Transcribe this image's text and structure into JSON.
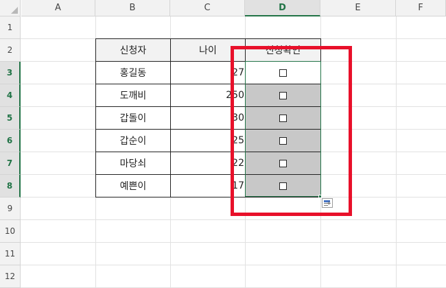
{
  "columns": [
    "A",
    "B",
    "C",
    "D",
    "E",
    "F"
  ],
  "rows": [
    "1",
    "2",
    "3",
    "4",
    "5",
    "6",
    "7",
    "8",
    "9",
    "10",
    "11",
    "12"
  ],
  "table": {
    "headers": [
      "신청자",
      "나이",
      "신청확인"
    ],
    "rows": [
      {
        "name": "홍길동",
        "age": "27"
      },
      {
        "name": "도깨비",
        "age": "250"
      },
      {
        "name": "갑돌이",
        "age": "30"
      },
      {
        "name": "갑순이",
        "age": "25"
      },
      {
        "name": "마당쇠",
        "age": "22"
      },
      {
        "name": "예쁜이",
        "age": "17"
      }
    ]
  },
  "selected_column": "D",
  "selected_rows": [
    "3",
    "4",
    "5",
    "6",
    "7",
    "8"
  ],
  "colors": {
    "accent": "#217346",
    "annotation": "#e8102a",
    "selection_fill": "#c8c8c8"
  },
  "icons": {
    "checkbox": "checkbox-icon",
    "quick_analysis": "quick-analysis-icon"
  }
}
